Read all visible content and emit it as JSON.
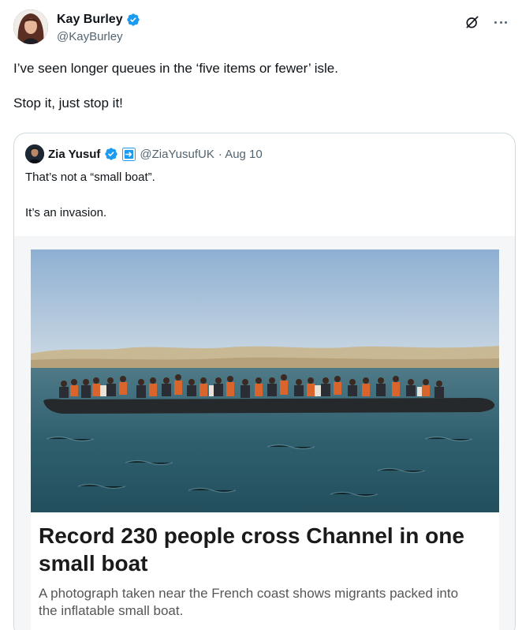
{
  "author": {
    "display_name": "Kay Burley",
    "handle": "@KayBurley"
  },
  "tweet": {
    "paragraphs": [
      "I’ve seen longer queues in the ‘five items or fewer’ isle.",
      "Stop it, just stop it!"
    ]
  },
  "quoted": {
    "display_name": "Zia Yusuf",
    "handle": "@ZiaYusufUK",
    "date": "· Aug 10",
    "paragraphs": [
      "That’s not a “small boat”.",
      "It’s an invasion."
    ]
  },
  "article": {
    "headline": "Record 230 people cross Channel in one small boat",
    "subhead": "A photograph taken near the French coast shows migrants packed into the inflatable small boat."
  },
  "colors": {
    "verified": "#1d9bf0",
    "secondary_text": "#536471",
    "border": "#cfd9de"
  },
  "icons": {
    "verified": "verified-badge-icon",
    "grok": "grok-icon",
    "more": "more-icon",
    "affiliate": "affiliate-badge-icon"
  }
}
